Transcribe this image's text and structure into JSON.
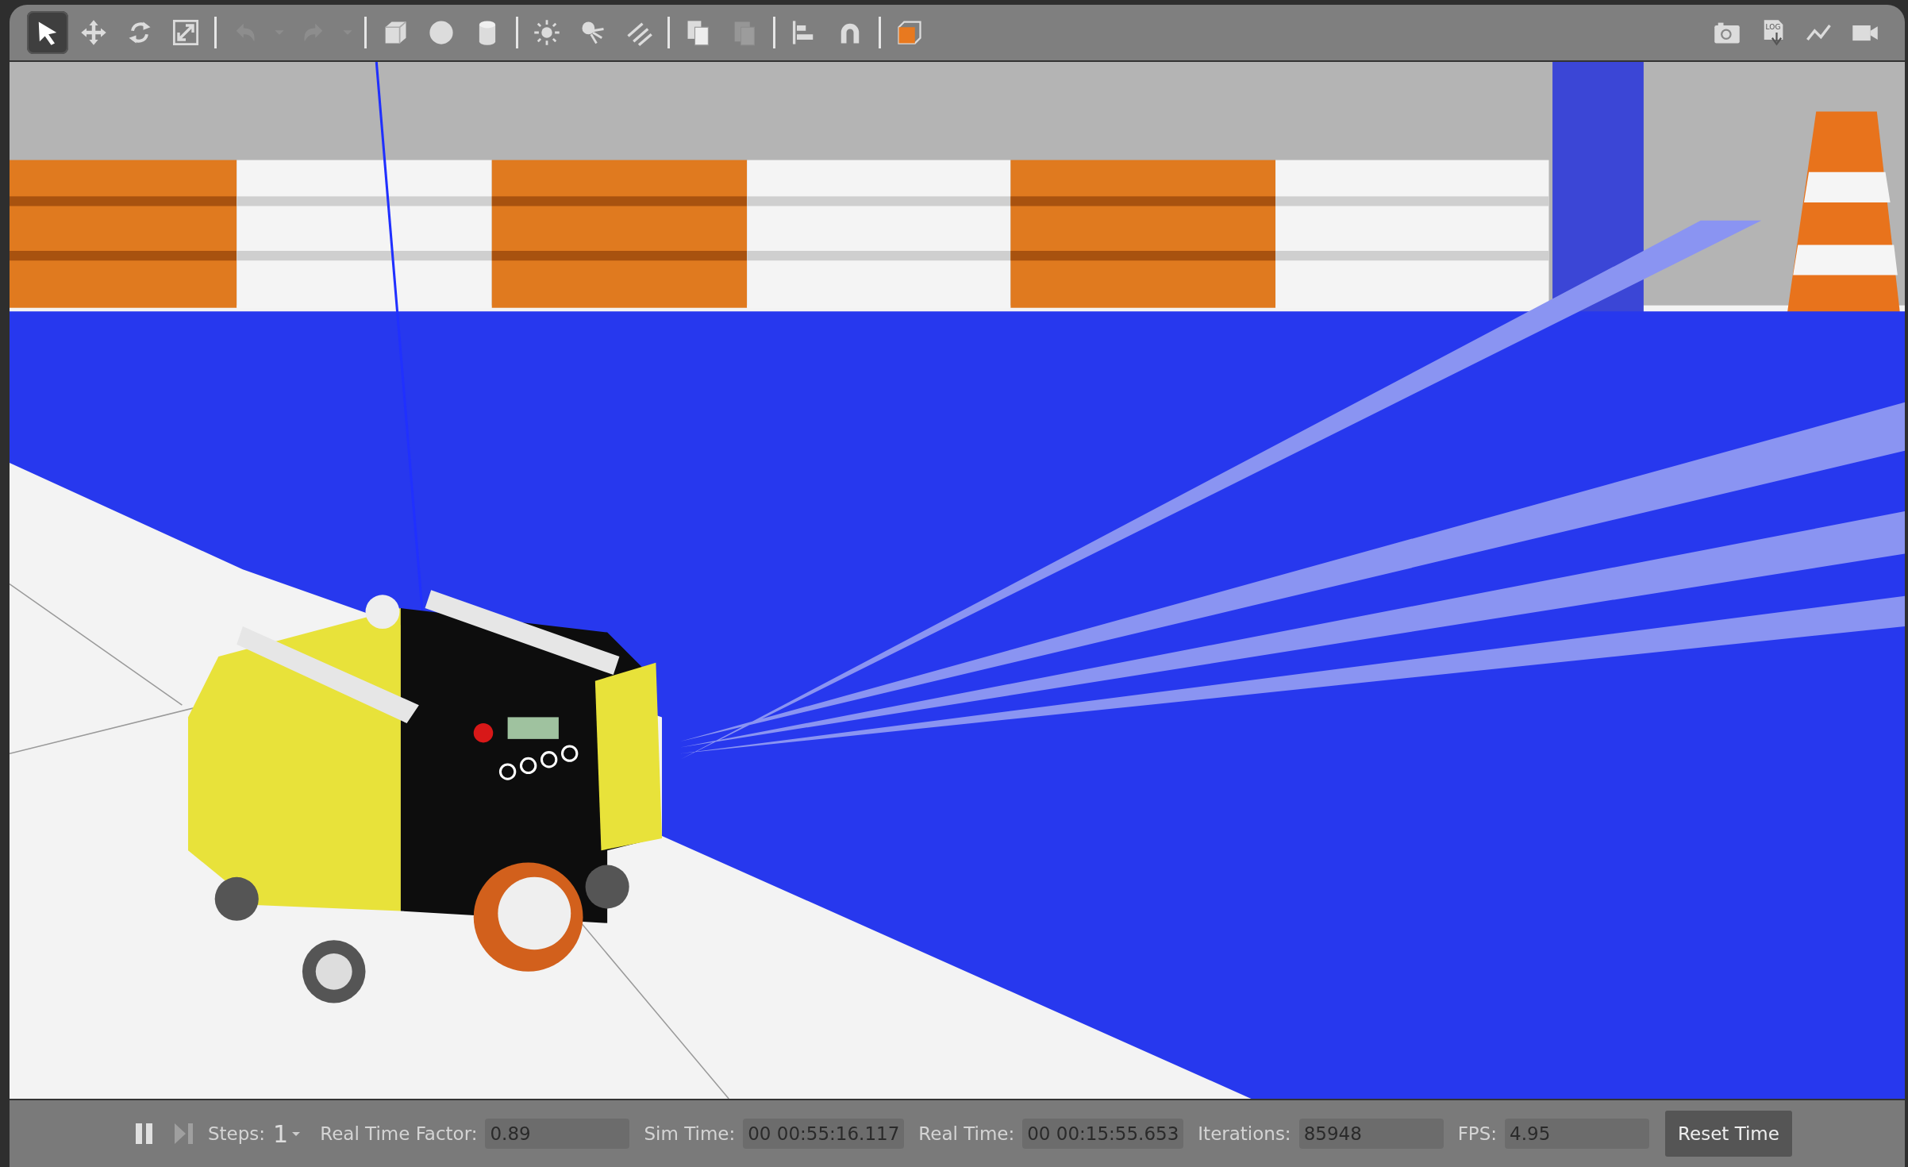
{
  "toolbar": {
    "tools": [
      {
        "kind": "select",
        "selected": true,
        "disabled": false
      },
      {
        "kind": "translate",
        "selected": false,
        "disabled": false
      },
      {
        "kind": "rotate",
        "selected": false,
        "disabled": false
      },
      {
        "kind": "scale",
        "selected": false,
        "disabled": false
      },
      {
        "kind": "separator"
      },
      {
        "kind": "undo",
        "selected": false,
        "disabled": true
      },
      {
        "kind": "dropdown",
        "selected": false,
        "disabled": true
      },
      {
        "kind": "redo",
        "selected": false,
        "disabled": true
      },
      {
        "kind": "dropdown",
        "selected": false,
        "disabled": true
      },
      {
        "kind": "separator"
      },
      {
        "kind": "box",
        "selected": false,
        "disabled": false
      },
      {
        "kind": "sphere",
        "selected": false,
        "disabled": false
      },
      {
        "kind": "cylinder",
        "selected": false,
        "disabled": false
      },
      {
        "kind": "separator"
      },
      {
        "kind": "point_light",
        "selected": false,
        "disabled": false
      },
      {
        "kind": "spot_light",
        "selected": false,
        "disabled": false
      },
      {
        "kind": "directional_light",
        "selected": false,
        "disabled": false
      },
      {
        "kind": "separator"
      },
      {
        "kind": "copy",
        "selected": false,
        "disabled": false
      },
      {
        "kind": "paste",
        "selected": false,
        "disabled": true
      },
      {
        "kind": "separator"
      },
      {
        "kind": "align",
        "selected": false,
        "disabled": false
      },
      {
        "kind": "snap",
        "selected": false,
        "disabled": false
      },
      {
        "kind": "separator"
      },
      {
        "kind": "view_angle",
        "selected": false,
        "disabled": false
      }
    ],
    "right_tools": [
      {
        "kind": "screenshot"
      },
      {
        "kind": "log",
        "log_label": "LOG"
      },
      {
        "kind": "plot"
      },
      {
        "kind": "video"
      }
    ]
  },
  "status_bar": {
    "play_paused": true,
    "step_disabled": true,
    "steps_label": "Steps:",
    "steps_value": "1",
    "fields": [
      {
        "label": "Real Time Factor:",
        "value": "0.89"
      },
      {
        "label": "Sim Time:",
        "value": "00 00:55:16.117"
      },
      {
        "label": "Real Time:",
        "value": "00 00:15:55.653"
      },
      {
        "label": "Iterations:",
        "value": "85948"
      },
      {
        "label": "FPS:",
        "value": "4.95"
      }
    ],
    "reset_button": "Reset Time"
  }
}
